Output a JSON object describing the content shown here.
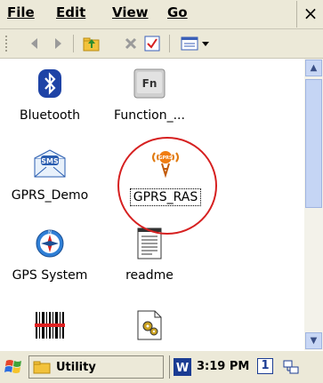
{
  "menu": {
    "file": "File",
    "edit": "Edit",
    "view": "View",
    "go": "Go",
    "close": "×"
  },
  "toolbar": {
    "icons": [
      "back-icon",
      "forward-icon",
      "up-folder-icon",
      "delete-icon",
      "properties-icon",
      "view-mode-icon"
    ]
  },
  "files": [
    {
      "label": "Bluetooth",
      "icon": "bluetooth-icon"
    },
    {
      "label": "Function_...",
      "icon": "function-key-icon"
    },
    {
      "label": "GPRS_Demo",
      "icon": "sms-envelope-icon"
    },
    {
      "label": "GPRS_RAS",
      "icon": "gprs-antenna-icon",
      "selected": true
    },
    {
      "label": "GPS System",
      "icon": "gps-compass-icon"
    },
    {
      "label": "readme",
      "icon": "text-document-icon"
    },
    {
      "label": "",
      "icon": "barcode-icon"
    },
    {
      "label": "",
      "icon": "settings-file-icon"
    }
  ],
  "taskbar": {
    "folder": "Utility",
    "time": "3:19 PM",
    "indicator": "1"
  },
  "colors": {
    "chrome": "#ece9d8",
    "accent_blue": "#1b3c93",
    "annotation_red": "#d62020"
  }
}
